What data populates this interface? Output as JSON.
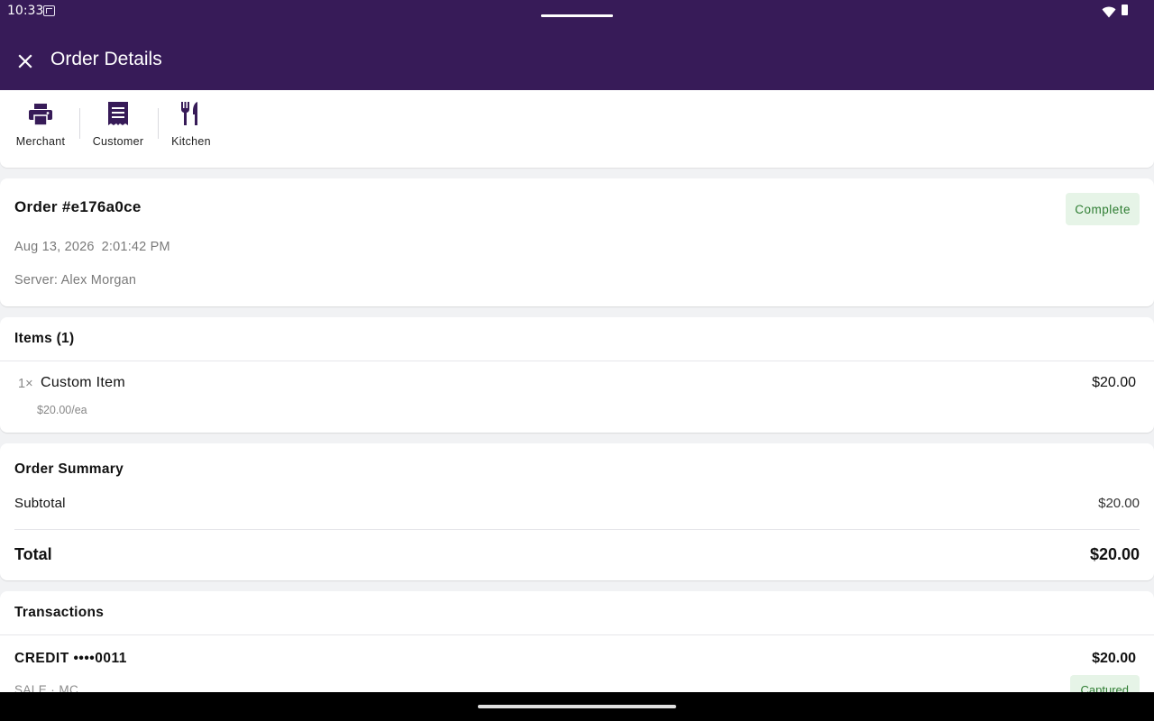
{
  "status_bar": {
    "time": "10:33"
  },
  "app_bar": {
    "title": "Order Details"
  },
  "print_actions": [
    {
      "label": "Merchant",
      "icon": "printer-icon"
    },
    {
      "label": "Customer",
      "icon": "receipt-icon"
    },
    {
      "label": "Kitchen",
      "icon": "utensils-icon"
    }
  ],
  "order": {
    "title": "Order #e176a0ce",
    "status": "Complete",
    "date": "Aug 13, 2026",
    "time": "2:01:42 PM",
    "server": "Server: Alex Morgan"
  },
  "items": {
    "header": "Items (1)",
    "list": [
      {
        "qty": "1×",
        "name": "Custom Item",
        "price": "$20.00",
        "each": "$20.00/ea"
      }
    ]
  },
  "summary": {
    "header": "Order Summary",
    "subtotal_label": "Subtotal",
    "subtotal_value": "$20.00",
    "total_label": "Total",
    "total_value": "$20.00"
  },
  "transactions": {
    "header": "Transactions",
    "list": [
      {
        "card": "CREDIT ••••0011",
        "amount": "$20.00",
        "type": "SALE · MC",
        "status": "Captured"
      }
    ]
  },
  "colors": {
    "primary": "#371b58",
    "success_bg": "#e6f4e7",
    "success_text": "#2e7d32"
  }
}
